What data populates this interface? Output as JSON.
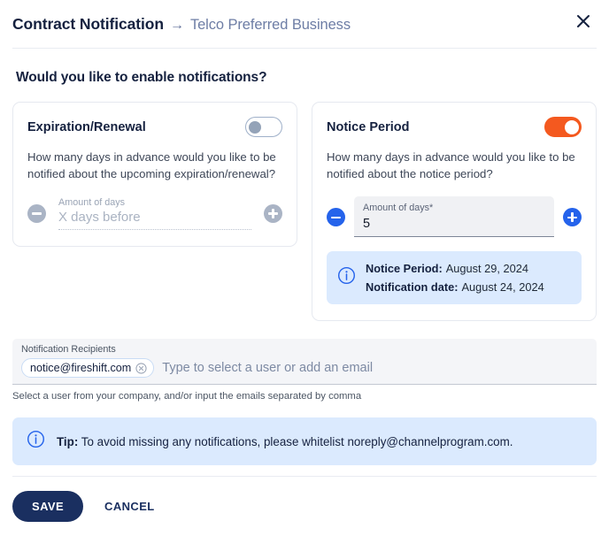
{
  "header": {
    "title": "Contract Notification",
    "separator": "→",
    "subtitle": "Telco Preferred Business",
    "close_label": "close-icon"
  },
  "main": {
    "question": "Would you like to enable notifications?"
  },
  "cards": [
    {
      "id": "expiration-renewal",
      "title": "Expiration/Renewal",
      "enabled": false,
      "description": "How many days in advance would you like to be notified about the upcoming expiration/renewal?",
      "decrement_label": "−",
      "increment_label": "+",
      "field_label": "Amount of days",
      "field_value": "",
      "field_placeholder": "X days before"
    },
    {
      "id": "notice-period",
      "title": "Notice Period",
      "enabled": true,
      "description": "How many days in advance would you like to be notified about the notice period?",
      "decrement_label": "−",
      "increment_label": "+",
      "field_label": "Amount of days*",
      "field_value": "5",
      "info": {
        "notice_period_label": "Notice Period:",
        "notice_period_value": "August 29, 2024",
        "notification_date_label": "Notification date:",
        "notification_date_value": "August 24, 2024"
      }
    }
  ],
  "recipients": {
    "label": "Notification Recipients",
    "chips": [
      {
        "email": "notice@fireshift.com"
      }
    ],
    "placeholder": "Type to select a user or add an email",
    "help": "Select a user from your company, and/or input the emails separated by comma"
  },
  "tip": {
    "prefix": "Tip:",
    "text": "To avoid missing any notifications, please whitelist noreply@channelprogram.com."
  },
  "footer": {
    "save_label": "SAVE",
    "cancel_label": "CANCEL"
  },
  "colors": {
    "accent_orange": "#f4591f",
    "accent_blue": "#2563eb",
    "navy": "#1a2f60",
    "info_bg": "#dbeafe"
  }
}
